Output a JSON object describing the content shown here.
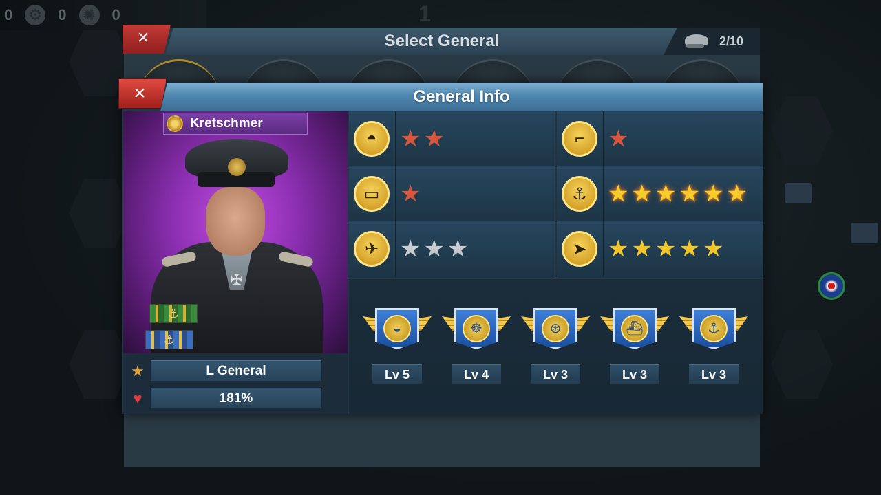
{
  "top_bar": {
    "resources": [
      {
        "icon": "gear-icon",
        "value": "0"
      },
      {
        "icon": "atom-icon",
        "value": "0"
      }
    ],
    "lead_value": "0",
    "center_value": "1"
  },
  "select_general": {
    "title": "Select General",
    "close_label": "×",
    "count": "2/10"
  },
  "general_info": {
    "title": "General Info",
    "close_label": "×",
    "name": "Kretschmer",
    "rank": "L General",
    "health": "181%",
    "stats": [
      {
        "icon": "infantry-helmet-icon",
        "stars": 2,
        "star_color": "red"
      },
      {
        "icon": "artillery-icon",
        "stars": 1,
        "star_color": "red"
      },
      {
        "icon": "tank-icon",
        "stars": 1,
        "star_color": "red"
      },
      {
        "icon": "navy-anchor-icon",
        "stars": 6,
        "star_color": "glow"
      },
      {
        "icon": "airforce-plane-icon",
        "stars": 3,
        "star_color": "silver"
      },
      {
        "icon": "march-arrow-icon",
        "stars": 5,
        "star_color": "gold"
      }
    ],
    "skills": [
      {
        "icon": "submarine-icon",
        "level": "Lv 5"
      },
      {
        "icon": "ship-wheel-icon",
        "level": "Lv 4"
      },
      {
        "icon": "torpedo-icon",
        "level": "Lv 3"
      },
      {
        "icon": "fleet-icon",
        "level": "Lv 3"
      },
      {
        "icon": "anchor-shield-icon",
        "level": "Lv 3"
      }
    ]
  },
  "colors": {
    "accent_blue": "#4f87b0",
    "close_red": "#c23a36",
    "star_gold": "#f2c62b",
    "star_red": "#d8553e",
    "portrait_purple": "#8b2fb1"
  }
}
